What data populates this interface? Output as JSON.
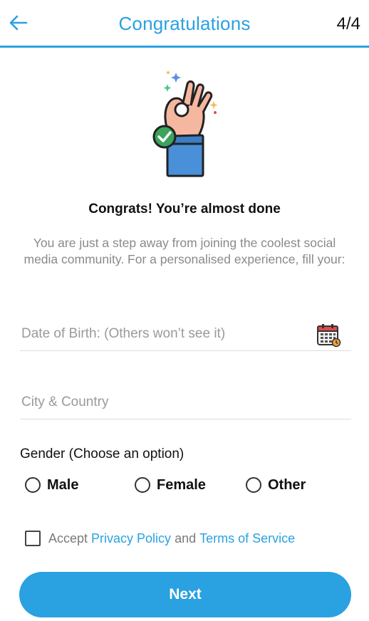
{
  "header": {
    "title": "Congratulations",
    "step": "4/4",
    "back_icon": "arrow-left-icon"
  },
  "hero": {
    "icon": "ok-hand-checkmark-illustration"
  },
  "main": {
    "heading": "Congrats! You’re almost done",
    "subtitle": "You are just a step away from joining the coolest social media community. For a personalised experience, fill your:"
  },
  "form": {
    "dob_placeholder": "Date of Birth: (Others won’t see it)",
    "calendar_icon": "calendar-icon",
    "city_placeholder": "City & Country",
    "gender_label": "Gender (Choose an option)",
    "gender_options": [
      "Male",
      "Female",
      "Other"
    ],
    "terms": {
      "prefix": "Accept",
      "privacy_link": "Privacy Policy",
      "and": "and",
      "terms_link": "Terms of Service"
    },
    "next_label": "Next"
  },
  "colors": {
    "accent": "#2aa1e0",
    "placeholder": "#9a9a9a",
    "body_text": "#111111"
  }
}
